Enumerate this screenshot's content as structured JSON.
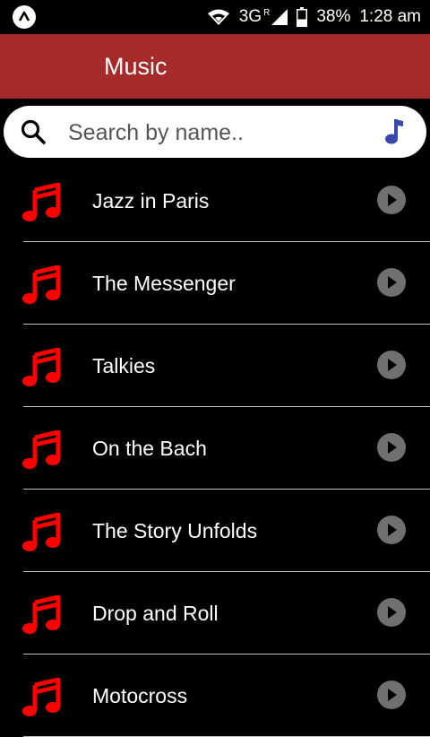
{
  "status_bar": {
    "network": "3G",
    "roaming": "R",
    "battery": "38%",
    "time": "1:28 am"
  },
  "app_bar": {
    "title": "Music"
  },
  "search": {
    "placeholder": "Search by name.."
  },
  "colors": {
    "app_bar": "#a52a2a",
    "music_icon": "#ff0000",
    "search_note_icon": "#3949ab",
    "play_icon": "#707070"
  },
  "songs": [
    {
      "title": "Jazz in Paris"
    },
    {
      "title": "The Messenger"
    },
    {
      "title": "Talkies"
    },
    {
      "title": "On the Bach"
    },
    {
      "title": "The Story Unfolds"
    },
    {
      "title": "Drop and Roll"
    },
    {
      "title": "Motocross"
    }
  ]
}
